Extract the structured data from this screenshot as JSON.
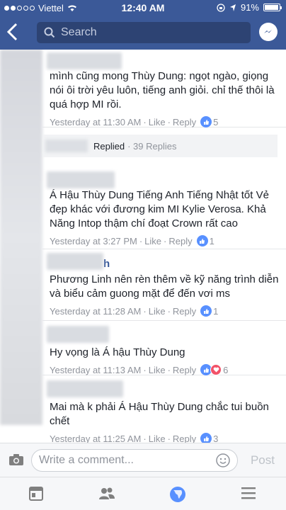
{
  "status": {
    "carrier": "Viettel",
    "time": "12:40 AM",
    "battery": "91%"
  },
  "nav": {
    "search_placeholder": "Search"
  },
  "comments": [
    {
      "text": "mình cũng mong Thùy Dung: ngọt ngào, giọng nói ôi trời yêu luôn, tiếng anh giỏi. chỉ thế thôi là quá hợp MI rồi.",
      "time": "Yesterday at 11:30 AM",
      "like": "Like",
      "reply": "Reply",
      "reactions": "5"
    },
    {
      "text": "Á Hậu Thùy Dung Tiếng Anh Tiếng Nhật tốt Vẻ đẹp khác với đương kim MI Kylie Verosa. Khả Năng Intop thậm chí đoạt Crown rất cao",
      "time": "Yesterday at 3:27 PM",
      "like": "Like",
      "reply": "Reply",
      "reactions": "1"
    },
    {
      "name_tail": "h",
      "text": "Phương Linh nên rèn thêm về kỹ năng trình diễn và biểu cảm guong mặt để đến vơi ms",
      "time": "Yesterday at 11:28 AM",
      "like": "Like",
      "reply": "Reply",
      "reactions": "1"
    },
    {
      "text": "Hy vọng là Á hậu Thùy Dung",
      "time": "Yesterday at 11:13 AM",
      "like": "Like",
      "reply": "Reply",
      "reactions": "6"
    },
    {
      "text": "Mai mà k phải Á Hậu Thùy Dung chắc tui buồn chết",
      "time": "Yesterday at 11:25 AM",
      "like": "Like",
      "reply": "Reply",
      "reactions": "3"
    }
  ],
  "replied": {
    "label": "Replied",
    "count": "· 39 Replies"
  },
  "composer": {
    "placeholder": "Write a comment...",
    "post": "Post"
  },
  "icons": [
    "back-icon",
    "search-icon",
    "messenger-icon",
    "camera-icon",
    "smiley-icon",
    "news-feed-icon",
    "friends-icon",
    "globe-icon",
    "menu-icon",
    "like-icon",
    "love-icon"
  ]
}
